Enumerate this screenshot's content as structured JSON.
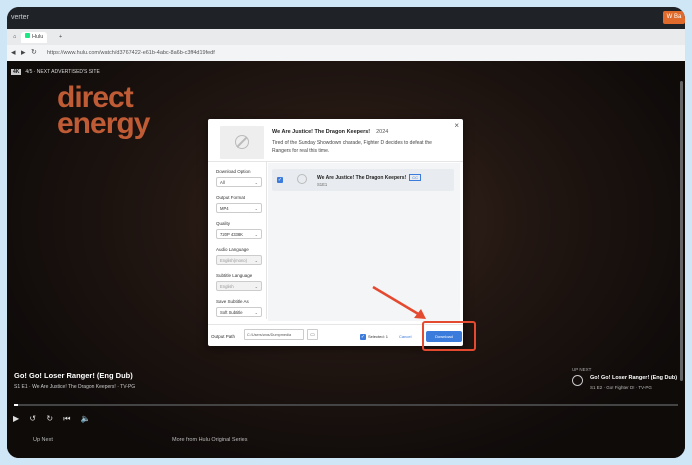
{
  "browser": {
    "title": "verter",
    "top_right_button": "W Ba",
    "tabs": [
      "Hulu"
    ],
    "url": "https://www.hulu.com/watch/d3767422-e61b-4abc-8a6b-c3ff4d19fedf"
  },
  "video": {
    "top_info": {
      "badge": "4K",
      "text": "4/5 · NEXT ADVERTISED'S SITE"
    },
    "ad_logo": [
      "direct",
      "energy"
    ],
    "show_title": "Go! Go! Loser Ranger! (Eng Dub)",
    "show_subtitle": "S1 E1 · We Are Justice! The Dragon Keepers! · TV-PG",
    "progress": 0.006,
    "up_next": "Up Next",
    "more_from": "More from Hulu Original Series",
    "right_next": {
      "label": "UP NEXT",
      "title": "Go! Go! Loser Ranger! (Eng Dub)",
      "subtitle": "S1 E2 · Go! Fighter D! · TV-PG"
    }
  },
  "dialog": {
    "close": "×",
    "title": "We Are Justice! The Dragon Keepers!",
    "year": "2024",
    "description": "Tired of the Sunday Showdown charade, Fighter D decides to defeat the Rangers for real this time.",
    "options": [
      {
        "label": "Download Option",
        "value": "All",
        "disabled": false
      },
      {
        "label": "Output Format",
        "value": "MP4",
        "disabled": false
      },
      {
        "label": "Quality",
        "value": "720P  4338K",
        "disabled": false
      },
      {
        "label": "Audio Language",
        "value": "English(mono)",
        "disabled": true
      },
      {
        "label": "Subtitle Language",
        "value": "English",
        "disabled": true
      },
      {
        "label": "Save Subtitle As",
        "value": "Soft Subtitle",
        "disabled": false
      }
    ],
    "episode": {
      "name": "We Are Justice! The Dragon Keepers!",
      "cc": "CC",
      "code": "S1E1"
    },
    "footer": {
      "output_label": "Output Path",
      "output_path": "C:/Users/wos/Dumpmedia",
      "selected": "Selected: 1",
      "cancel": "Cancel",
      "download": "Download"
    }
  }
}
